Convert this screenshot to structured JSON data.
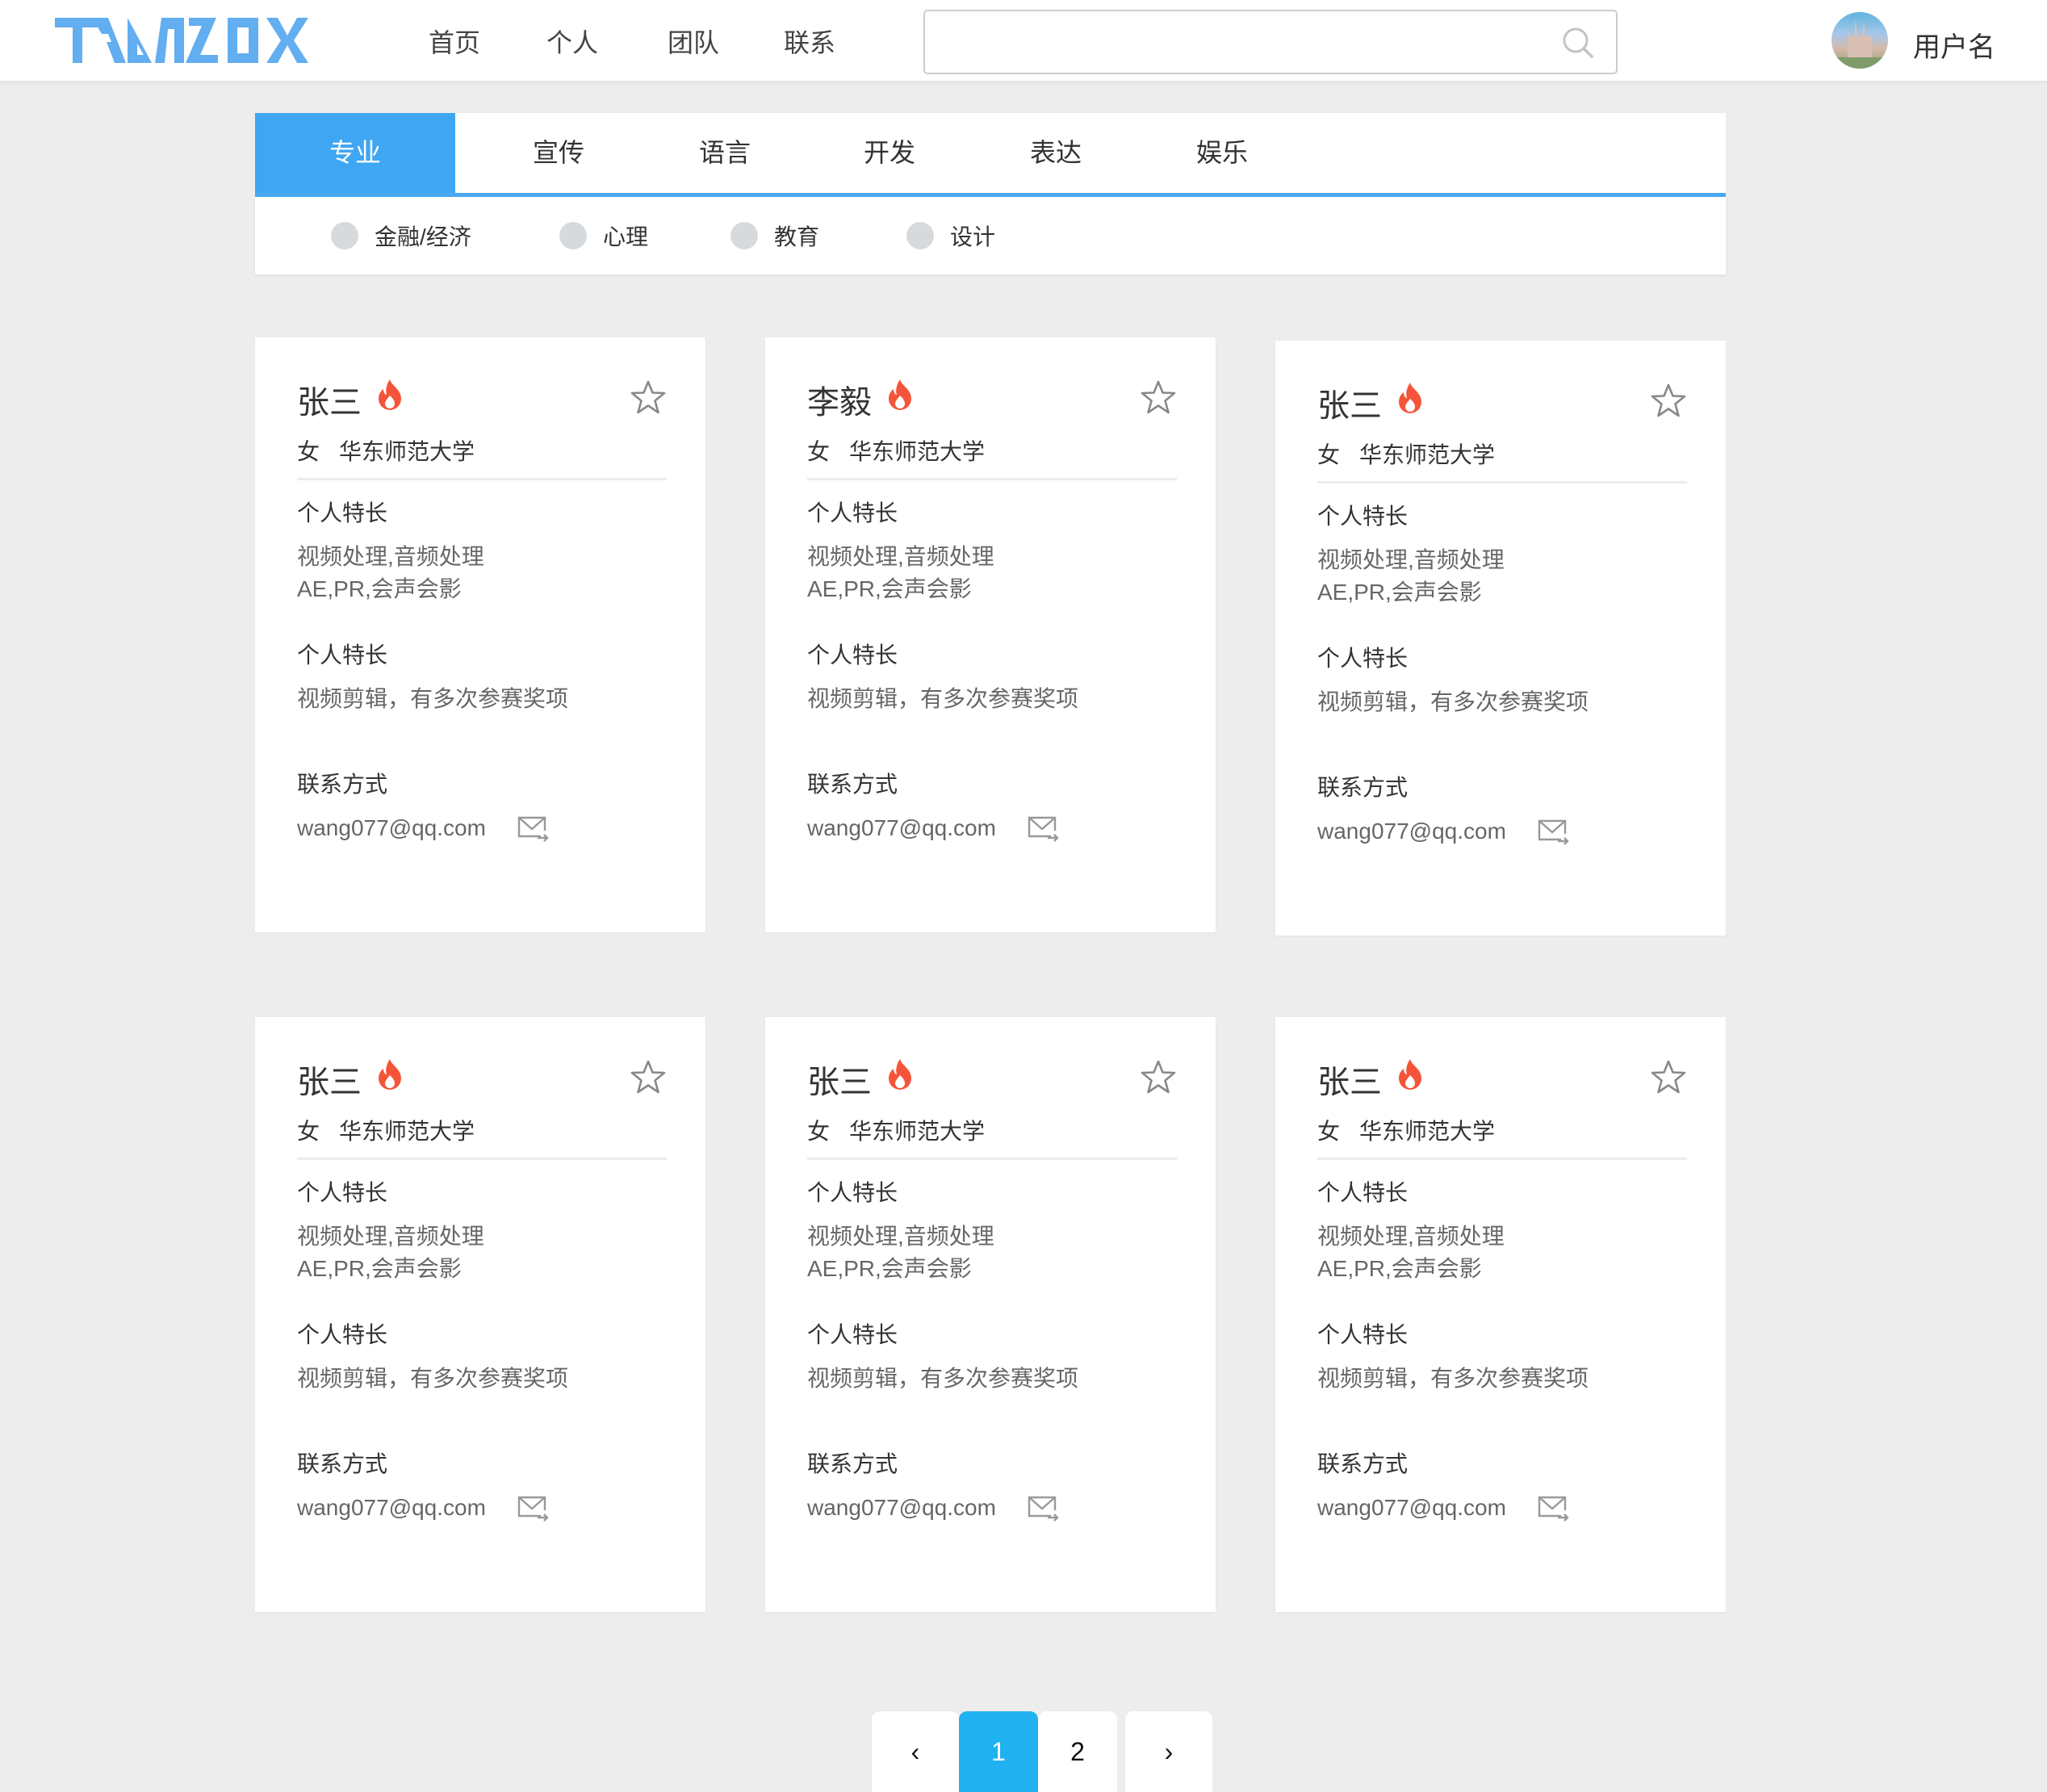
{
  "header": {
    "logo_text": "TEAMBOX",
    "nav": [
      "首页",
      "个人",
      "团队",
      "联系"
    ],
    "search": {
      "value": "",
      "placeholder": ""
    },
    "username": "用户名"
  },
  "colors": {
    "accent": "#3ea6f3",
    "fire": "#f4553a",
    "page_active": "#20b2f0",
    "background": "#ededed"
  },
  "tabs": [
    {
      "label": "专业",
      "active": true
    },
    {
      "label": "宣传"
    },
    {
      "label": "语言"
    },
    {
      "label": "开发"
    },
    {
      "label": "表达"
    },
    {
      "label": "娱乐"
    }
  ],
  "filters": [
    "金融/经济",
    "心理",
    "教育",
    "设计"
  ],
  "cards": [
    {
      "name": "张三",
      "gender": "女",
      "school": "华东师范大学",
      "label1": "个人特长",
      "skills1": "视频处理,音频处理",
      "skills2": "AE,PR,会声会影",
      "label2": "个人特长",
      "desc": "视频剪辑，有多次参赛奖项",
      "contact_label": "联系方式",
      "email": "wang077@qq.com"
    },
    {
      "name": "李毅",
      "gender": "女",
      "school": "华东师范大学",
      "label1": "个人特长",
      "skills1": "视频处理,音频处理",
      "skills2": "AE,PR,会声会影",
      "label2": "个人特长",
      "desc": "视频剪辑，有多次参赛奖项",
      "contact_label": "联系方式",
      "email": "wang077@qq.com"
    },
    {
      "name": "张三",
      "gender": "女",
      "school": "华东师范大学",
      "label1": "个人特长",
      "skills1": "视频处理,音频处理",
      "skills2": "AE,PR,会声会影",
      "label2": "个人特长",
      "desc": "视频剪辑，有多次参赛奖项",
      "contact_label": "联系方式",
      "email": "wang077@qq.com"
    },
    {
      "name": "张三",
      "gender": "女",
      "school": "华东师范大学",
      "label1": "个人特长",
      "skills1": "视频处理,音频处理",
      "skills2": "AE,PR,会声会影",
      "label2": "个人特长",
      "desc": "视频剪辑，有多次参赛奖项",
      "contact_label": "联系方式",
      "email": "wang077@qq.com"
    },
    {
      "name": "张三",
      "gender": "女",
      "school": "华东师范大学",
      "label1": "个人特长",
      "skills1": "视频处理,音频处理",
      "skills2": "AE,PR,会声会影",
      "label2": "个人特长",
      "desc": "视频剪辑，有多次参赛奖项",
      "contact_label": "联系方式",
      "email": "wang077@qq.com"
    },
    {
      "name": "张三",
      "gender": "女",
      "school": "华东师范大学",
      "label1": "个人特长",
      "skills1": "视频处理,音频处理",
      "skills2": "AE,PR,会声会影",
      "label2": "个人特长",
      "desc": "视频剪辑，有多次参赛奖项",
      "contact_label": "联系方式",
      "email": "wang077@qq.com"
    }
  ],
  "pagination": {
    "prev": "‹",
    "pages": [
      "1",
      "2"
    ],
    "current": "1",
    "next": "›"
  }
}
